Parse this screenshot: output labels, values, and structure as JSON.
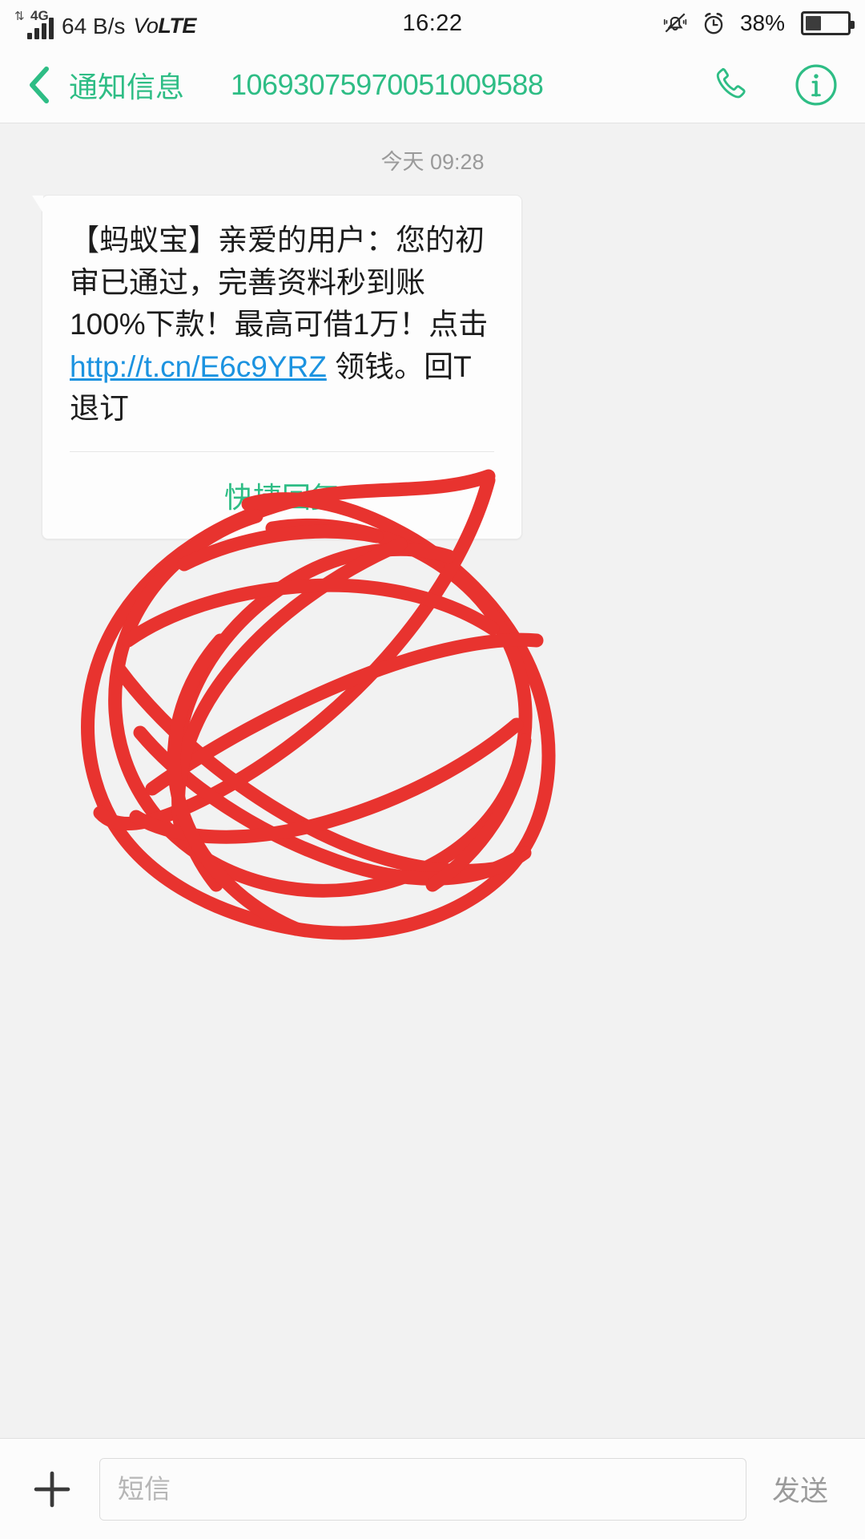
{
  "status_bar": {
    "network_type": "4G",
    "data_speed": "64 B/s",
    "volte_prefix": "Vo",
    "volte_suffix": "LTE",
    "time": "16:22",
    "battery_percent": "38%",
    "battery_level": 38,
    "icons": [
      "signal-bars-icon",
      "mute-bell-icon",
      "alarm-clock-icon",
      "battery-icon"
    ]
  },
  "header": {
    "back_label": "chevron-left-icon",
    "title": "通知信息",
    "sender_number": "10693075970051009588",
    "call_icon": "phone-icon",
    "info_icon": "info-circle-icon",
    "accent_color": "#2ebd85"
  },
  "conversation": {
    "day_stamp": "今天 09:28",
    "message": {
      "text_before_link": "【蚂蚁宝】亲爱的用户：您的初审已通过，完善资料秒到账100%下款！最高可借1万！点击 ",
      "link_text": "http://t.cn/E6c9YRZ",
      "link_color": "#1c93e0",
      "text_after_link": " 领钱。回T退订",
      "quick_reply_label": "快捷回复"
    },
    "annotation": {
      "type": "hand-drawn-scribble",
      "color": "#e8332f",
      "description": "red scribbled circle covering the middle of the screen"
    }
  },
  "composer": {
    "add_label": "+",
    "input_value": "",
    "input_placeholder": "短信",
    "send_label": "发送"
  }
}
